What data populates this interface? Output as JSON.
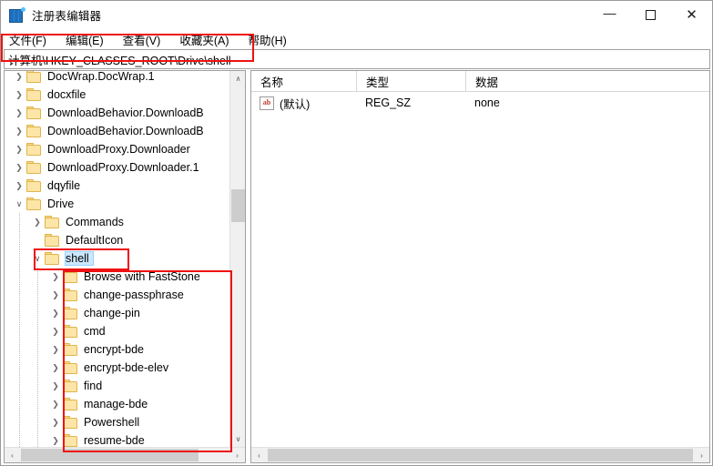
{
  "window": {
    "title": "注册表编辑器",
    "icon": "registry-icon",
    "controls": {
      "minimize": "—",
      "maximize": "□",
      "close": "✕"
    }
  },
  "menubar": {
    "items": [
      {
        "label": "文件(F)"
      },
      {
        "label": "编辑(E)"
      },
      {
        "label": "查看(V)"
      },
      {
        "label": "收藏夹(A)"
      },
      {
        "label": "帮助(H)"
      }
    ]
  },
  "address": {
    "path": "计算机\\HKEY_CLASSES_ROOT\\Drive\\shell",
    "placeholder": ""
  },
  "tree": {
    "nodes": [
      {
        "label": "DocWrap.DocWrap.1",
        "indent": 1,
        "state": "collapsed",
        "selected": false
      },
      {
        "label": "docxfile",
        "indent": 1,
        "state": "collapsed",
        "selected": false
      },
      {
        "label": "DownloadBehavior.DownloadB",
        "indent": 1,
        "state": "collapsed",
        "selected": false
      },
      {
        "label": "DownloadBehavior.DownloadB",
        "indent": 1,
        "state": "collapsed",
        "selected": false
      },
      {
        "label": "DownloadProxy.Downloader",
        "indent": 1,
        "state": "collapsed",
        "selected": false
      },
      {
        "label": "DownloadProxy.Downloader.1",
        "indent": 1,
        "state": "collapsed",
        "selected": false
      },
      {
        "label": "dqyfile",
        "indent": 1,
        "state": "collapsed",
        "selected": false
      },
      {
        "label": "Drive",
        "indent": 1,
        "state": "expanded",
        "selected": false
      },
      {
        "label": "Commands",
        "indent": 2,
        "state": "collapsed",
        "selected": false
      },
      {
        "label": "DefaultIcon",
        "indent": 2,
        "state": "leaf",
        "selected": false
      },
      {
        "label": "shell",
        "indent": 2,
        "state": "expanded",
        "selected": true
      },
      {
        "label": "Browse with FastStone",
        "indent": 3,
        "state": "collapsed",
        "selected": false
      },
      {
        "label": "change-passphrase",
        "indent": 3,
        "state": "collapsed",
        "selected": false
      },
      {
        "label": "change-pin",
        "indent": 3,
        "state": "collapsed",
        "selected": false
      },
      {
        "label": "cmd",
        "indent": 3,
        "state": "collapsed",
        "selected": false
      },
      {
        "label": "encrypt-bde",
        "indent": 3,
        "state": "collapsed",
        "selected": false
      },
      {
        "label": "encrypt-bde-elev",
        "indent": 3,
        "state": "collapsed",
        "selected": false
      },
      {
        "label": "find",
        "indent": 3,
        "state": "collapsed",
        "selected": false
      },
      {
        "label": "manage-bde",
        "indent": 3,
        "state": "collapsed",
        "selected": false
      },
      {
        "label": "Powershell",
        "indent": 3,
        "state": "collapsed",
        "selected": false
      },
      {
        "label": "resume-bde",
        "indent": 3,
        "state": "collapsed",
        "selected": false
      }
    ],
    "chevron_collapsed": "❯",
    "chevron_expanded": "∨",
    "scroll": {
      "up_arrow": "∧",
      "down_arrow": "∨",
      "left_arrow": "‹",
      "right_arrow": "›"
    }
  },
  "values": {
    "columns": [
      {
        "label": "名称"
      },
      {
        "label": "类型"
      },
      {
        "label": "数据"
      }
    ],
    "rows": [
      {
        "name": "(默认)",
        "type": "REG_SZ",
        "data": "none",
        "icon": "string-value-icon",
        "icon_text": "ab"
      }
    ],
    "scroll": {
      "left_arrow": "‹",
      "right_arrow": "›"
    }
  },
  "annotations": [
    {
      "name": "address-bar-highlight"
    },
    {
      "name": "shell-node-highlight"
    },
    {
      "name": "shell-children-highlight"
    }
  ],
  "colors": {
    "selection": "#cce8ff",
    "annotation": "#ee1111",
    "folder": "#fce5a6",
    "scrollbar_thumb": "#cdcdcd"
  }
}
